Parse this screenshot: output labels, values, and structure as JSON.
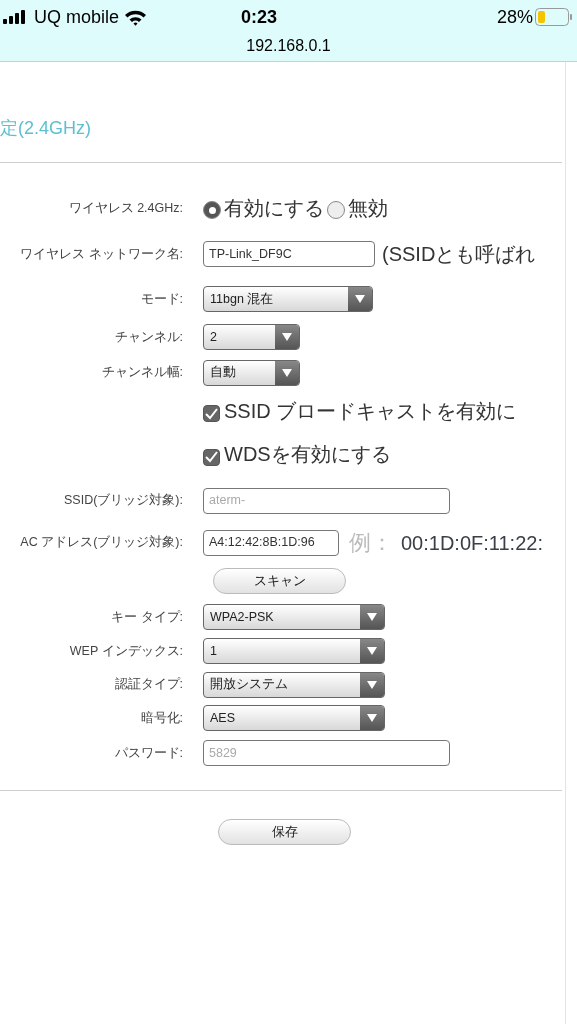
{
  "status_bar": {
    "carrier": "UQ mobile",
    "time": "0:23",
    "battery": "28%"
  },
  "address": "192.168.0.1",
  "section_title": "定(2.4GHz)",
  "fields": [
    {
      "kind": "radio",
      "label": "ワイヤレス 2.4GHz:",
      "options": [
        {
          "label": "有効にする",
          "selected": true
        },
        {
          "label": "無効",
          "selected": false
        }
      ]
    },
    {
      "kind": "text",
      "label": "ワイヤレス ネットワーク名:",
      "value": "TP-Link_DF9C",
      "disabled": false,
      "note": "(SSIDとも呼ばれ"
    },
    {
      "kind": "select",
      "label": "モード:",
      "value": "11bgn 混在"
    },
    {
      "kind": "select",
      "label": "チャンネル:",
      "value": "2"
    },
    {
      "kind": "select",
      "label": "チャンネル幅:",
      "value": "自動"
    },
    {
      "kind": "checkbox",
      "text": "SSID ブロードキャストを有効に",
      "checked": true
    },
    {
      "kind": "checkbox",
      "text": "WDSを有効にする",
      "checked": true
    },
    {
      "kind": "text",
      "label": "SSID(ブリッジ対象):",
      "value": "aterm-",
      "disabled": true
    },
    {
      "kind": "text",
      "label": "AC アドレス(ブリッジ対象):",
      "value": "A4:12:42:8B:1D:96",
      "disabled": false,
      "example_label": "例：",
      "example": "00:1D:0F:11:22:"
    },
    {
      "kind": "button",
      "label": "スキャン"
    },
    {
      "kind": "select",
      "label": "キー タイプ:",
      "value": "WPA2-PSK"
    },
    {
      "kind": "select",
      "label": "WEP インデックス:",
      "value": "1"
    },
    {
      "kind": "select",
      "label": "認証タイプ:",
      "value": "開放システム"
    },
    {
      "kind": "select",
      "label": "暗号化:",
      "value": "AES"
    },
    {
      "kind": "text",
      "label": "パスワード:",
      "value": "5829",
      "disabled": true
    }
  ],
  "save_button": "保存"
}
